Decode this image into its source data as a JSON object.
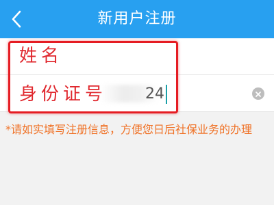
{
  "header": {
    "title": "新用户注册",
    "back_icon": "chevron-left-icon",
    "background_color": "#28a0f0"
  },
  "form": {
    "name_label": "姓名",
    "id_label": "身份证号",
    "id_value_visible_tail": "24",
    "clear_icon": "clear-circle-icon"
  },
  "notice": {
    "text": "*请如实填写注册信息，方便您日后社保业务的办理",
    "color": "#f07328"
  },
  "annotation": {
    "highlight_color": "#e51c23"
  }
}
